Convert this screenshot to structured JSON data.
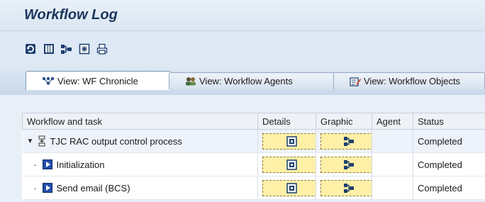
{
  "window": {
    "title": "Workflow Log"
  },
  "toolbar": {
    "buttons": [
      {
        "name": "refresh-icon"
      },
      {
        "name": "layout-icon"
      },
      {
        "name": "graphic-icon"
      },
      {
        "name": "filter-icon"
      },
      {
        "name": "print-icon"
      }
    ]
  },
  "tabs": [
    {
      "label": "View: WF Chronicle",
      "active": true,
      "icon": "chronicle-icon"
    },
    {
      "label": "View: Workflow Agents",
      "active": false,
      "icon": "agents-icon"
    },
    {
      "label": "View: Workflow Objects",
      "active": false,
      "icon": "objects-icon"
    }
  ],
  "table": {
    "columns": [
      "Workflow and task",
      "Details",
      "Graphic",
      "Agent",
      "Status"
    ],
    "rows": [
      {
        "task": "TJC RAC output control process",
        "agent": "",
        "status": "Completed",
        "level": 0
      },
      {
        "task": "Initialization",
        "agent": "",
        "status": "Completed",
        "level": 1
      },
      {
        "task": "Send email (BCS)",
        "agent": "",
        "status": "Completed",
        "level": 1
      }
    ]
  },
  "colors": {
    "background": "#dfe9f5",
    "title": "#19355a",
    "button_fill": "#fff0a8",
    "task_icon": "#1f4fa8"
  }
}
